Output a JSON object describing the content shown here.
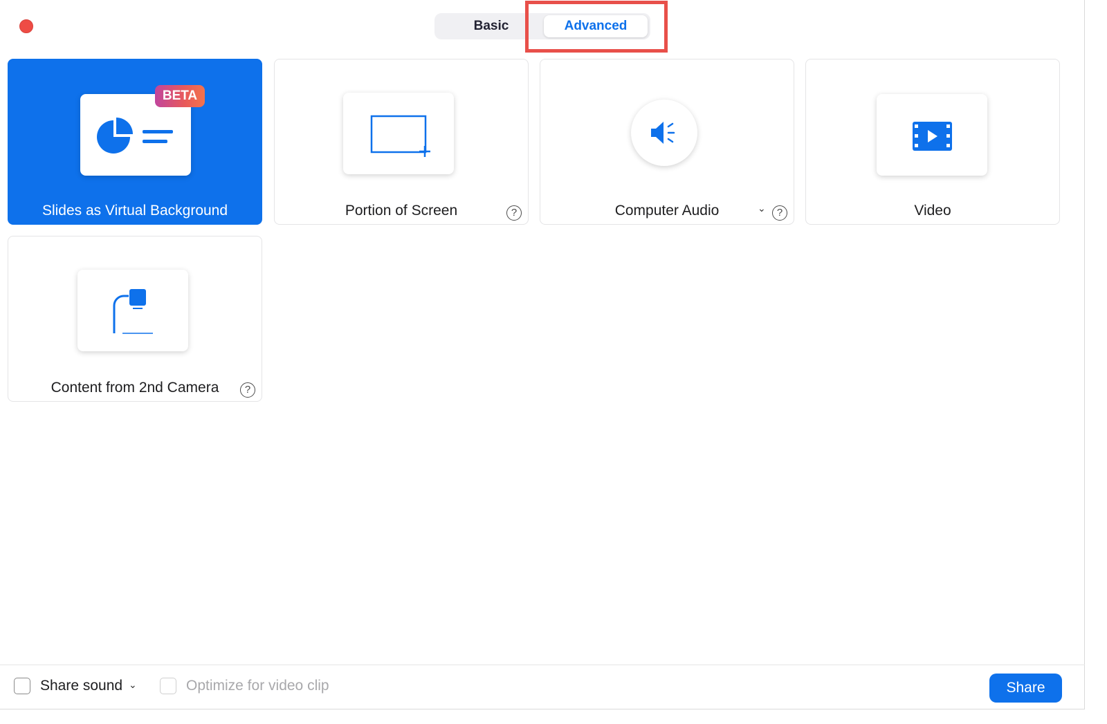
{
  "segmented_control": {
    "basic_label": "Basic",
    "advanced_label": "Advanced",
    "selected": "Advanced"
  },
  "tiles": [
    {
      "label": "Slides as Virtual Background",
      "badge": "BETA",
      "icon": "slides-pie-chart-icon",
      "selected": true
    },
    {
      "label": "Portion of Screen",
      "icon": "portion-of-screen-icon",
      "help": "?"
    },
    {
      "label": "Computer Audio",
      "icon": "speaker-icon",
      "dropdown": "⌄",
      "help": "?"
    },
    {
      "label": "Video",
      "icon": "film-play-icon"
    },
    {
      "label": "Content from 2nd Camera",
      "icon": "document-camera-icon",
      "help": "?"
    }
  ],
  "footer": {
    "share_sound_label": "Share sound",
    "share_sound_dropdown": "⌄",
    "optimize_label": "Optimize for video clip",
    "share_button_label": "Share"
  },
  "colors": {
    "accent": "#0e71eb",
    "close_button": "#ee4c45",
    "highlight_annotation": "#e8504a"
  }
}
